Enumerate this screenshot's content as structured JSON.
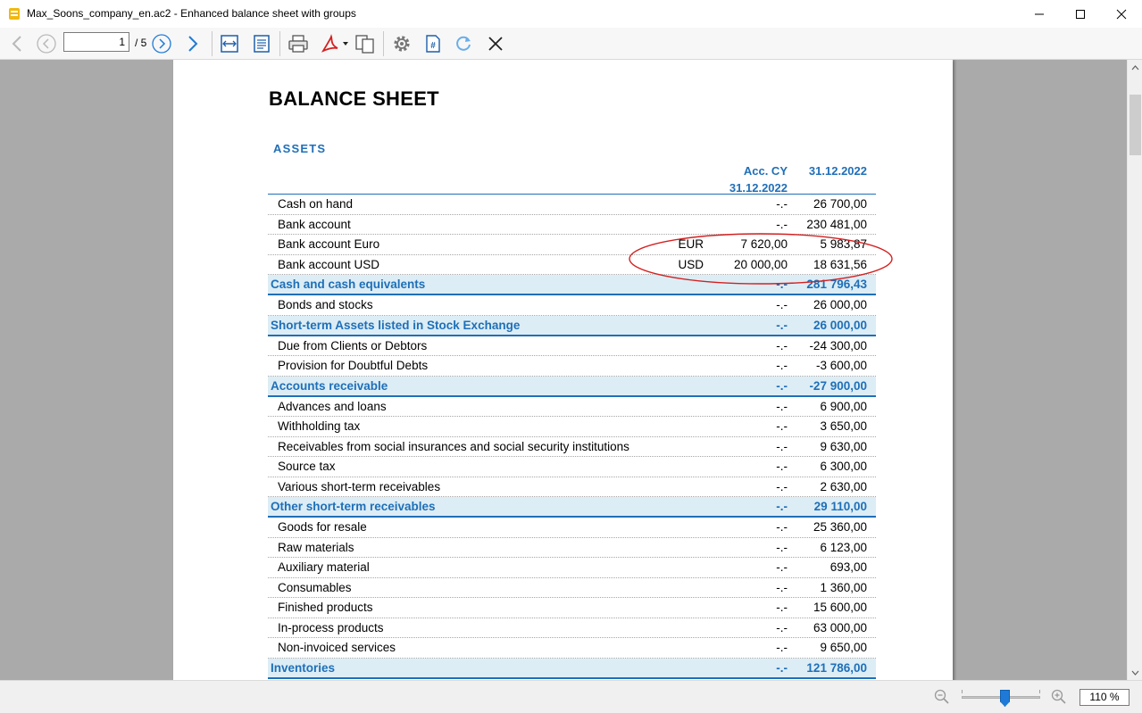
{
  "window": {
    "title": "Max_Soons_company_en.ac2 - Enhanced balance sheet with groups"
  },
  "toolbar": {
    "page_number": "1",
    "page_total": "/ 5",
    "icons": [
      "back-arrow-icon",
      "previous-page-icon",
      "next-page-icon",
      "forward-arrow-icon",
      "fit-width-icon",
      "fit-page-icon",
      "print-icon",
      "pdf-export-icon",
      "copy-icon",
      "settings-icon",
      "page-number-icon",
      "refresh-icon",
      "close-icon"
    ]
  },
  "document": {
    "title": "BALANCE SHEET",
    "section": "ASSETS",
    "col_header_acc_line1": "Acc. CY",
    "col_header_acc_line2": "31.12.2022",
    "col_header_date": "31.12.2022",
    "rows": [
      {
        "type": "line",
        "desc": "Cash on hand",
        "cur": "",
        "acc": "-.-",
        "val": "26 700,00"
      },
      {
        "type": "line",
        "desc": "Bank account",
        "cur": "",
        "acc": "-.-",
        "val": "230 481,00"
      },
      {
        "type": "line",
        "desc": "Bank account Euro",
        "cur": "EUR",
        "acc": "7 620,00",
        "val": "5 983,87"
      },
      {
        "type": "line",
        "desc": "Bank account USD",
        "cur": "USD",
        "acc": "20 000,00",
        "val": "18 631,56"
      },
      {
        "type": "group",
        "desc": "Cash and cash equivalents",
        "cur": "",
        "acc": "-.-",
        "val": "281 796,43"
      },
      {
        "type": "line",
        "desc": "Bonds and stocks",
        "cur": "",
        "acc": "-.-",
        "val": "26 000,00"
      },
      {
        "type": "group",
        "desc": "Short-term Assets listed in Stock Exchange",
        "cur": "",
        "acc": "-.-",
        "val": "26 000,00"
      },
      {
        "type": "line",
        "desc": "Due from Clients or Debtors",
        "cur": "",
        "acc": "-.-",
        "val": "-24 300,00"
      },
      {
        "type": "line",
        "desc": "Provision for Doubtful Debts",
        "cur": "",
        "acc": "-.-",
        "val": "-3 600,00"
      },
      {
        "type": "group",
        "desc": "Accounts receivable",
        "cur": "",
        "acc": "-.-",
        "val": "-27 900,00"
      },
      {
        "type": "line",
        "desc": "Advances and loans",
        "cur": "",
        "acc": "-.-",
        "val": "6 900,00"
      },
      {
        "type": "line",
        "desc": "Withholding tax",
        "cur": "",
        "acc": "-.-",
        "val": "3 650,00"
      },
      {
        "type": "line",
        "desc": "Receivables from social insurances and social security institutions",
        "cur": "",
        "acc": "-.-",
        "val": "9 630,00"
      },
      {
        "type": "line",
        "desc": "Source tax",
        "cur": "",
        "acc": "-.-",
        "val": "6 300,00"
      },
      {
        "type": "line",
        "desc": "Various short-term receivables",
        "cur": "",
        "acc": "-.-",
        "val": "2 630,00"
      },
      {
        "type": "group",
        "desc": "Other short-term receivables",
        "cur": "",
        "acc": "-.-",
        "val": "29 110,00"
      },
      {
        "type": "line",
        "desc": "Goods for resale",
        "cur": "",
        "acc": "-.-",
        "val": "25 360,00"
      },
      {
        "type": "line",
        "desc": "Raw materials",
        "cur": "",
        "acc": "-.-",
        "val": "6 123,00"
      },
      {
        "type": "line",
        "desc": "Auxiliary material",
        "cur": "",
        "acc": "-.-",
        "val": "693,00"
      },
      {
        "type": "line",
        "desc": "Consumables",
        "cur": "",
        "acc": "-.-",
        "val": "1 360,00"
      },
      {
        "type": "line",
        "desc": "Finished products",
        "cur": "",
        "acc": "-.-",
        "val": "15 600,00"
      },
      {
        "type": "line",
        "desc": "In-process products",
        "cur": "",
        "acc": "-.-",
        "val": "63 000,00"
      },
      {
        "type": "line",
        "desc": "Non-invoiced services",
        "cur": "",
        "acc": "-.-",
        "val": "9 650,00"
      },
      {
        "type": "group",
        "desc": "Inventories",
        "cur": "",
        "acc": "-.-",
        "val": "121 786,00"
      }
    ]
  },
  "annotation": {
    "color": "#d42020"
  },
  "statusbar": {
    "zoom": "110 %",
    "zoom_level_percent": 110
  },
  "colors": {
    "accent": "#1f6fb8",
    "group_bg": "#dcedf5",
    "viewer_bg": "#aaaaaa"
  }
}
